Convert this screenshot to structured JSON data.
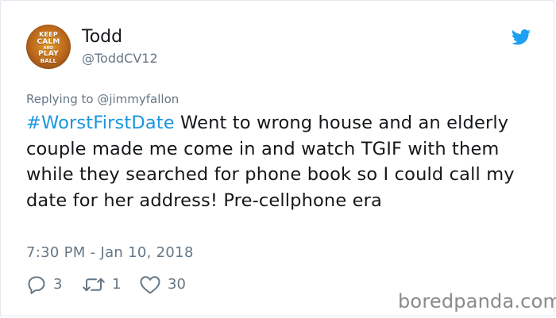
{
  "author": {
    "name": "Todd",
    "handle": "@ToddCV12",
    "avatar_text": [
      "KEEP",
      "CALM",
      "AND",
      "PLAY",
      "BALL"
    ]
  },
  "reply_prefix": "Replying to ",
  "reply_to": "@jimmyfallon",
  "tweet": {
    "hashtag": "#WorstFirstDate",
    "text": " Went to wrong house and an elderly couple made me come in and watch TGIF with them while they searched for phone book so I could call my date for her address! Pre-cellphone era"
  },
  "timestamp": "7:30 PM - Jan 10, 2018",
  "actions": {
    "replies": "3",
    "retweets": "1",
    "likes": "30"
  },
  "icons": [
    "twitter-bird-icon",
    "reply-icon",
    "retweet-icon",
    "like-icon"
  ],
  "colors": {
    "accent": "#1b95e0",
    "muted": "#657786",
    "text": "#14171a"
  },
  "watermark": "boredpanda.com"
}
